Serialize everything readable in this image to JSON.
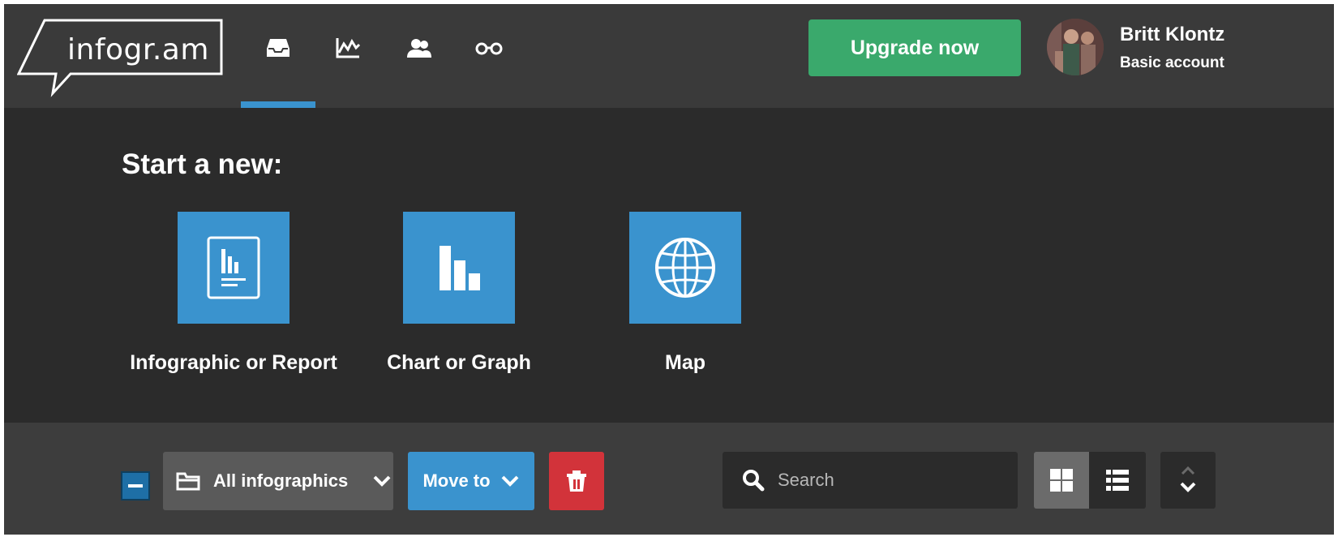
{
  "brand": {
    "logo_text": "infogr.am"
  },
  "nav": {
    "items": [
      {
        "icon": "inbox-icon"
      },
      {
        "icon": "line-chart-icon"
      },
      {
        "icon": "users-icon"
      },
      {
        "icon": "glasses-icon"
      }
    ],
    "active_index": 0
  },
  "header": {
    "upgrade_label": "Upgrade now",
    "user_name": "Britt Klontz",
    "user_plan": "Basic account"
  },
  "start": {
    "title": "Start a new:",
    "tiles": [
      {
        "label": "Infographic or Report",
        "icon": "report-icon"
      },
      {
        "label": "Chart or Graph",
        "icon": "bar-chart-icon"
      },
      {
        "label": "Map",
        "icon": "globe-icon"
      }
    ]
  },
  "toolbar": {
    "folder_label": "All infographics",
    "move_label": "Move to",
    "search_placeholder": "Search",
    "search_value": ""
  },
  "colors": {
    "accent": "#3a93ce",
    "upgrade": "#3aa96c",
    "delete": "#d2333a",
    "header_bg": "#3a3a3a",
    "body_bg": "#2b2b2b"
  }
}
